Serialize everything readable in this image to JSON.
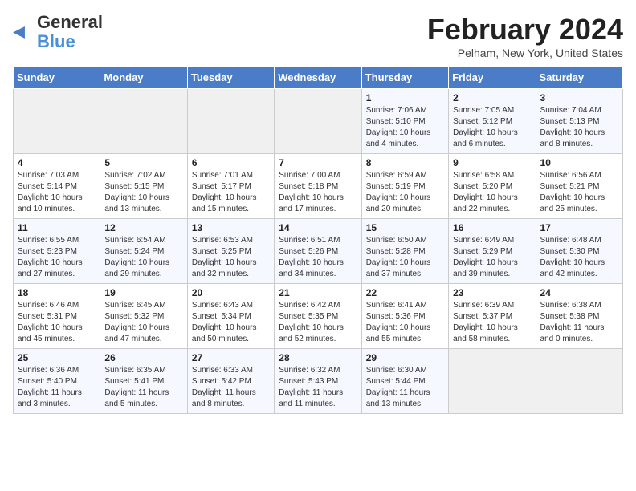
{
  "logo": {
    "text_general": "General",
    "text_blue": "Blue",
    "icon": "▶"
  },
  "header": {
    "title": "February 2024",
    "subtitle": "Pelham, New York, United States"
  },
  "weekdays": [
    "Sunday",
    "Monday",
    "Tuesday",
    "Wednesday",
    "Thursday",
    "Friday",
    "Saturday"
  ],
  "weeks": [
    [
      {
        "day": "",
        "info": ""
      },
      {
        "day": "",
        "info": ""
      },
      {
        "day": "",
        "info": ""
      },
      {
        "day": "",
        "info": ""
      },
      {
        "day": "1",
        "info": "Sunrise: 7:06 AM\nSunset: 5:10 PM\nDaylight: 10 hours\nand 4 minutes."
      },
      {
        "day": "2",
        "info": "Sunrise: 7:05 AM\nSunset: 5:12 PM\nDaylight: 10 hours\nand 6 minutes."
      },
      {
        "day": "3",
        "info": "Sunrise: 7:04 AM\nSunset: 5:13 PM\nDaylight: 10 hours\nand 8 minutes."
      }
    ],
    [
      {
        "day": "4",
        "info": "Sunrise: 7:03 AM\nSunset: 5:14 PM\nDaylight: 10 hours\nand 10 minutes."
      },
      {
        "day": "5",
        "info": "Sunrise: 7:02 AM\nSunset: 5:15 PM\nDaylight: 10 hours\nand 13 minutes."
      },
      {
        "day": "6",
        "info": "Sunrise: 7:01 AM\nSunset: 5:17 PM\nDaylight: 10 hours\nand 15 minutes."
      },
      {
        "day": "7",
        "info": "Sunrise: 7:00 AM\nSunset: 5:18 PM\nDaylight: 10 hours\nand 17 minutes."
      },
      {
        "day": "8",
        "info": "Sunrise: 6:59 AM\nSunset: 5:19 PM\nDaylight: 10 hours\nand 20 minutes."
      },
      {
        "day": "9",
        "info": "Sunrise: 6:58 AM\nSunset: 5:20 PM\nDaylight: 10 hours\nand 22 minutes."
      },
      {
        "day": "10",
        "info": "Sunrise: 6:56 AM\nSunset: 5:21 PM\nDaylight: 10 hours\nand 25 minutes."
      }
    ],
    [
      {
        "day": "11",
        "info": "Sunrise: 6:55 AM\nSunset: 5:23 PM\nDaylight: 10 hours\nand 27 minutes."
      },
      {
        "day": "12",
        "info": "Sunrise: 6:54 AM\nSunset: 5:24 PM\nDaylight: 10 hours\nand 29 minutes."
      },
      {
        "day": "13",
        "info": "Sunrise: 6:53 AM\nSunset: 5:25 PM\nDaylight: 10 hours\nand 32 minutes."
      },
      {
        "day": "14",
        "info": "Sunrise: 6:51 AM\nSunset: 5:26 PM\nDaylight: 10 hours\nand 34 minutes."
      },
      {
        "day": "15",
        "info": "Sunrise: 6:50 AM\nSunset: 5:28 PM\nDaylight: 10 hours\nand 37 minutes."
      },
      {
        "day": "16",
        "info": "Sunrise: 6:49 AM\nSunset: 5:29 PM\nDaylight: 10 hours\nand 39 minutes."
      },
      {
        "day": "17",
        "info": "Sunrise: 6:48 AM\nSunset: 5:30 PM\nDaylight: 10 hours\nand 42 minutes."
      }
    ],
    [
      {
        "day": "18",
        "info": "Sunrise: 6:46 AM\nSunset: 5:31 PM\nDaylight: 10 hours\nand 45 minutes."
      },
      {
        "day": "19",
        "info": "Sunrise: 6:45 AM\nSunset: 5:32 PM\nDaylight: 10 hours\nand 47 minutes."
      },
      {
        "day": "20",
        "info": "Sunrise: 6:43 AM\nSunset: 5:34 PM\nDaylight: 10 hours\nand 50 minutes."
      },
      {
        "day": "21",
        "info": "Sunrise: 6:42 AM\nSunset: 5:35 PM\nDaylight: 10 hours\nand 52 minutes."
      },
      {
        "day": "22",
        "info": "Sunrise: 6:41 AM\nSunset: 5:36 PM\nDaylight: 10 hours\nand 55 minutes."
      },
      {
        "day": "23",
        "info": "Sunrise: 6:39 AM\nSunset: 5:37 PM\nDaylight: 10 hours\nand 58 minutes."
      },
      {
        "day": "24",
        "info": "Sunrise: 6:38 AM\nSunset: 5:38 PM\nDaylight: 11 hours\nand 0 minutes."
      }
    ],
    [
      {
        "day": "25",
        "info": "Sunrise: 6:36 AM\nSunset: 5:40 PM\nDaylight: 11 hours\nand 3 minutes."
      },
      {
        "day": "26",
        "info": "Sunrise: 6:35 AM\nSunset: 5:41 PM\nDaylight: 11 hours\nand 5 minutes."
      },
      {
        "day": "27",
        "info": "Sunrise: 6:33 AM\nSunset: 5:42 PM\nDaylight: 11 hours\nand 8 minutes."
      },
      {
        "day": "28",
        "info": "Sunrise: 6:32 AM\nSunset: 5:43 PM\nDaylight: 11 hours\nand 11 minutes."
      },
      {
        "day": "29",
        "info": "Sunrise: 6:30 AM\nSunset: 5:44 PM\nDaylight: 11 hours\nand 13 minutes."
      },
      {
        "day": "",
        "info": ""
      },
      {
        "day": "",
        "info": ""
      }
    ]
  ]
}
